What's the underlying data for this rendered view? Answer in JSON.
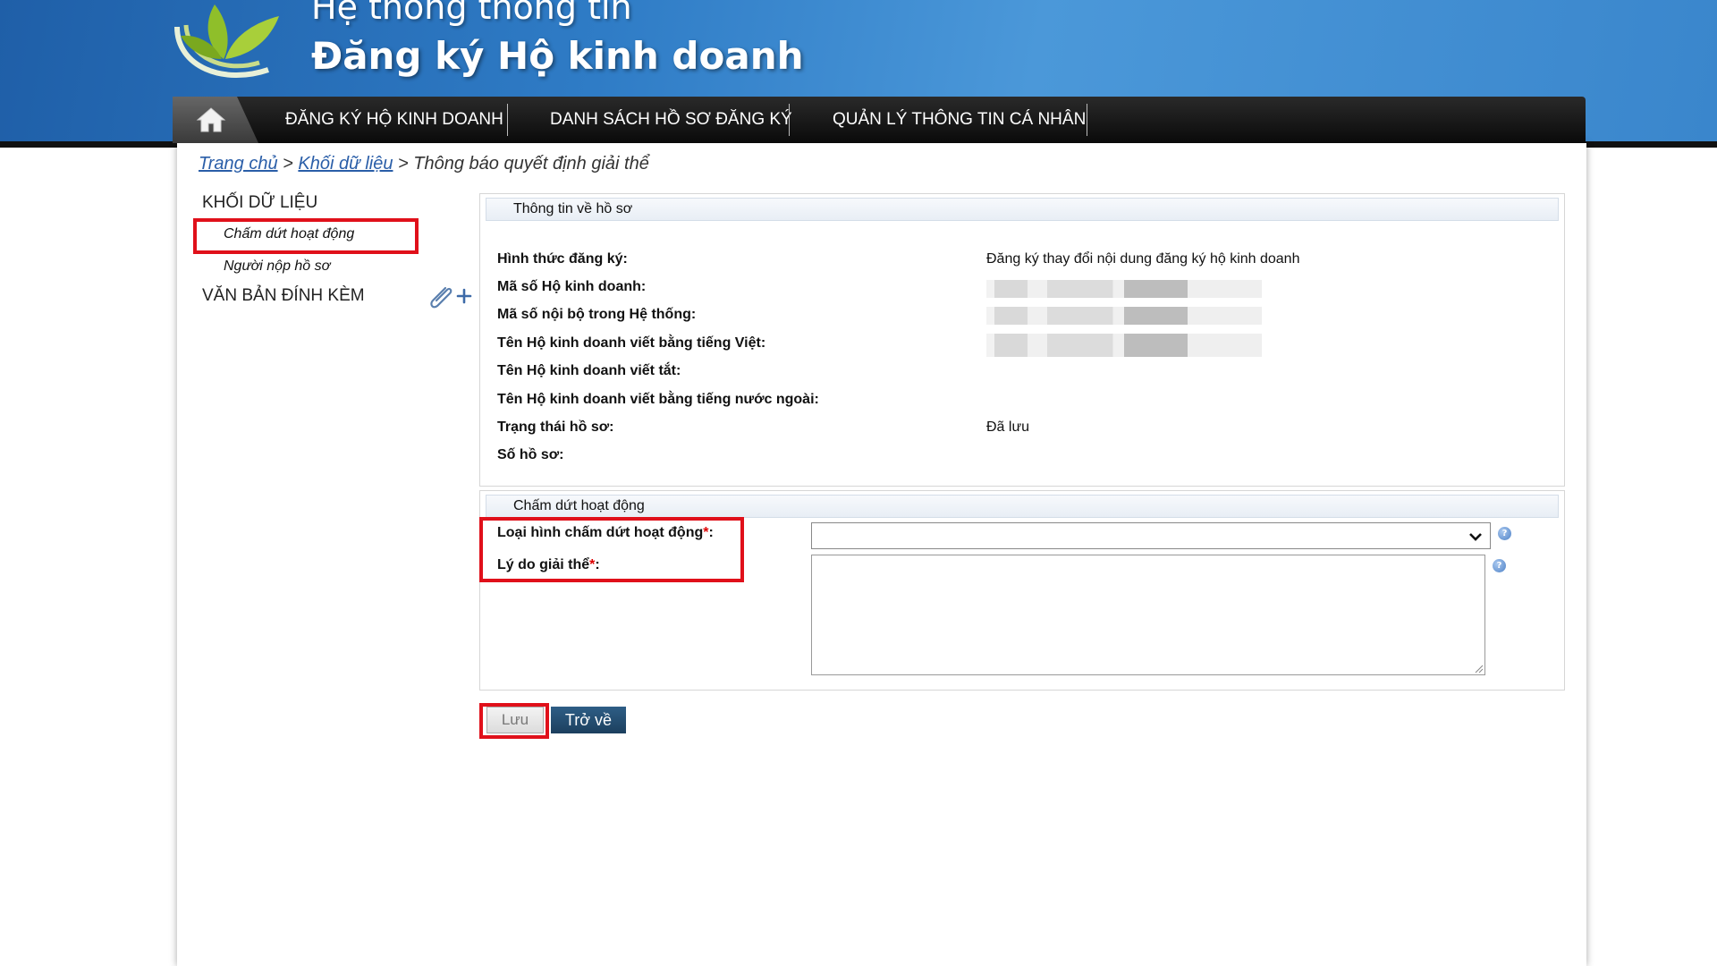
{
  "header": {
    "title_line1": "Hệ thống thông tin",
    "title_line2": "Đăng ký Hộ kinh doanh"
  },
  "nav": {
    "home_icon": "home-icon",
    "items": [
      {
        "label": "ĐĂNG KÝ HỘ KINH DOANH"
      },
      {
        "label": "DANH SÁCH HỒ SƠ ĐĂNG KÝ"
      },
      {
        "label": "QUẢN LÝ THÔNG TIN CÁ NHÂN"
      }
    ]
  },
  "breadcrumb": {
    "home": "Trang chủ",
    "sep": ">",
    "section": "Khối dữ liệu",
    "current": "Thông báo quyết định giải thể"
  },
  "sidebar": {
    "heading_data": "KHỐI DỮ LIỆU",
    "items": [
      {
        "label": "Chấm dứt hoạt động"
      },
      {
        "label": "Người nộp hồ sơ"
      }
    ],
    "heading_attach": "VĂN BẢN ĐÍNH KÈM",
    "attach_icon": "paperclip-add-icon"
  },
  "info_panel": {
    "title": "Thông tin về hồ sơ",
    "rows": [
      {
        "label": "Hình thức đăng ký:",
        "value": "Đăng ký thay đổi nội dung đăng ký hộ kinh doanh"
      },
      {
        "label": "Mã số Hộ kinh doanh:",
        "value": ""
      },
      {
        "label": "Mã số nội bộ trong Hệ thống:",
        "value": ""
      },
      {
        "label": "Tên Hộ kinh doanh viết bằng tiếng Việt:",
        "value": ""
      },
      {
        "label": "Tên Hộ kinh doanh viết tắt:",
        "value": ""
      },
      {
        "label": "Tên Hộ kinh doanh viết bằng tiếng nước ngoài:",
        "value": ""
      },
      {
        "label": "Trạng thái hồ sơ:",
        "value": "Đã lưu"
      },
      {
        "label": "Số hồ sơ:",
        "value": ""
      }
    ]
  },
  "termination_panel": {
    "title": "Chấm dứt hoạt động",
    "type_label": "Loại hình chấm dứt hoạt động",
    "reason_label": "Lý do giải thể",
    "required_mark": "*",
    "colon": ":",
    "type_selected": "",
    "reason_value": ""
  },
  "buttons": {
    "save": "Lưu",
    "back": "Trở về"
  },
  "colors": {
    "highlight": "#e0101a",
    "link": "#2a5ea8",
    "back_button": "#1c3f5e"
  }
}
